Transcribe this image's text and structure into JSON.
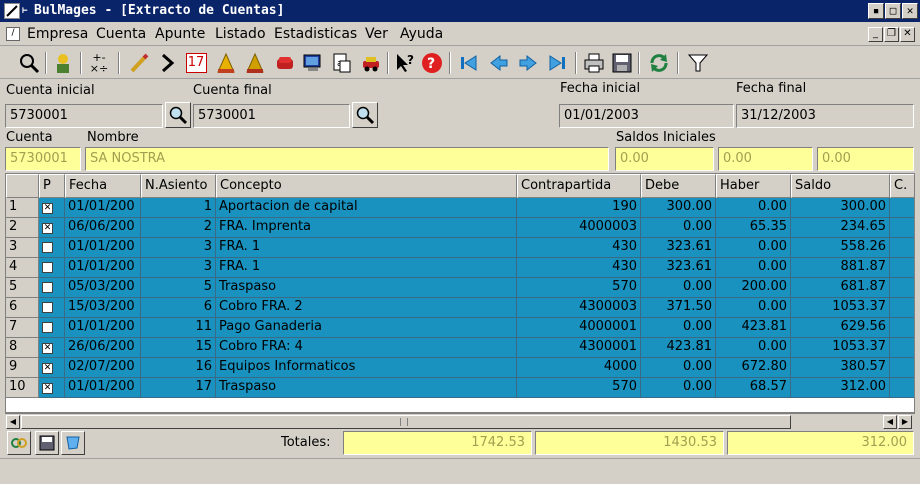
{
  "window": {
    "title": "BulMages  - [Extracto de Cuentas]"
  },
  "menu": [
    "Empresa",
    "Cuenta",
    "Apunte",
    "Listado",
    "Estadisticas",
    "Ver",
    "Ayuda"
  ],
  "toolbar_icons": [
    "search-icon",
    "person-icon",
    "calculator-icon",
    "pencil-icon",
    "chevron-right-icon",
    "calendar-icon",
    "balance-icon",
    "balance2-icon",
    "sofa-icon",
    "monitor-icon",
    "document-icon",
    "car-icon",
    "whats-this-icon",
    "help-icon",
    "first-icon",
    "previous-icon",
    "next-icon",
    "last-icon",
    "print-icon",
    "save-icon",
    "refresh-icon",
    "filter-icon"
  ],
  "calendar_day": "17",
  "filters": {
    "cuenta_inicial_label": "Cuenta inicial",
    "cuenta_inicial_value": "5730001",
    "cuenta_final_label": "Cuenta final",
    "cuenta_final_value": "5730001",
    "fecha_inicial_label": "Fecha inicial",
    "fecha_inicial_value": "01/01/2003",
    "fecha_final_label": "Fecha final",
    "fecha_final_value": "31/12/2003"
  },
  "cuenta": {
    "cuenta_label": "Cuenta",
    "nombre_label": "Nombre",
    "saldos_label": "Saldos Iniciales",
    "cuenta_value": "5730001",
    "nombre_value": "SA NOSTRA",
    "saldo1": "0.00",
    "saldo2": "0.00",
    "saldo3": "0.00"
  },
  "table": {
    "headers": [
      "P",
      "Fecha",
      "N.Asiento",
      "Concepto",
      "Contrapartida",
      "Debe",
      "Haber",
      "Saldo",
      "C."
    ],
    "rows": [
      {
        "n": "1",
        "p": true,
        "fecha": "01/01/200",
        "asiento": "1",
        "concepto": "Aportacion de capital",
        "contra": "190",
        "debe": "300.00",
        "haber": "0.00",
        "saldo": "300.00"
      },
      {
        "n": "2",
        "p": true,
        "fecha": "06/06/200",
        "asiento": "2",
        "concepto": "FRA. Imprenta",
        "contra": "4000003",
        "debe": "0.00",
        "haber": "65.35",
        "saldo": "234.65"
      },
      {
        "n": "3",
        "p": false,
        "fecha": "01/01/200",
        "asiento": "3",
        "concepto": "FRA. 1",
        "contra": "430",
        "debe": "323.61",
        "haber": "0.00",
        "saldo": "558.26"
      },
      {
        "n": "4",
        "p": false,
        "fecha": "01/01/200",
        "asiento": "3",
        "concepto": "FRA. 1",
        "contra": "430",
        "debe": "323.61",
        "haber": "0.00",
        "saldo": "881.87"
      },
      {
        "n": "5",
        "p": false,
        "fecha": "05/03/200",
        "asiento": "5",
        "concepto": "Traspaso",
        "contra": "570",
        "debe": "0.00",
        "haber": "200.00",
        "saldo": "681.87"
      },
      {
        "n": "6",
        "p": false,
        "fecha": "15/03/200",
        "asiento": "6",
        "concepto": "Cobro FRA. 2",
        "contra": "4300003",
        "debe": "371.50",
        "haber": "0.00",
        "saldo": "1053.37"
      },
      {
        "n": "7",
        "p": false,
        "fecha": "01/01/200",
        "asiento": "11",
        "concepto": "Pago Ganaderia",
        "contra": "4000001",
        "debe": "0.00",
        "haber": "423.81",
        "saldo": "629.56"
      },
      {
        "n": "8",
        "p": true,
        "fecha": "26/06/200",
        "asiento": "15",
        "concepto": "Cobro FRA: 4",
        "contra": "4300001",
        "debe": "423.81",
        "haber": "0.00",
        "saldo": "1053.37"
      },
      {
        "n": "9",
        "p": true,
        "fecha": "02/07/200",
        "asiento": "16",
        "concepto": "Equipos Informaticos",
        "contra": "4000",
        "debe": "0.00",
        "haber": "672.80",
        "saldo": "380.57"
      },
      {
        "n": "10",
        "p": true,
        "fecha": "01/01/200",
        "asiento": "17",
        "concepto": "Traspaso",
        "contra": "570",
        "debe": "0.00",
        "haber": "68.57",
        "saldo": "312.00"
      }
    ]
  },
  "totals": {
    "label": "Totales:",
    "debe": "1742.53",
    "haber": "1430.53",
    "saldo": "312.00"
  },
  "colors": {
    "titlebar": "#0a246a",
    "row": "#1992c0",
    "highlight": "#ffff99"
  }
}
